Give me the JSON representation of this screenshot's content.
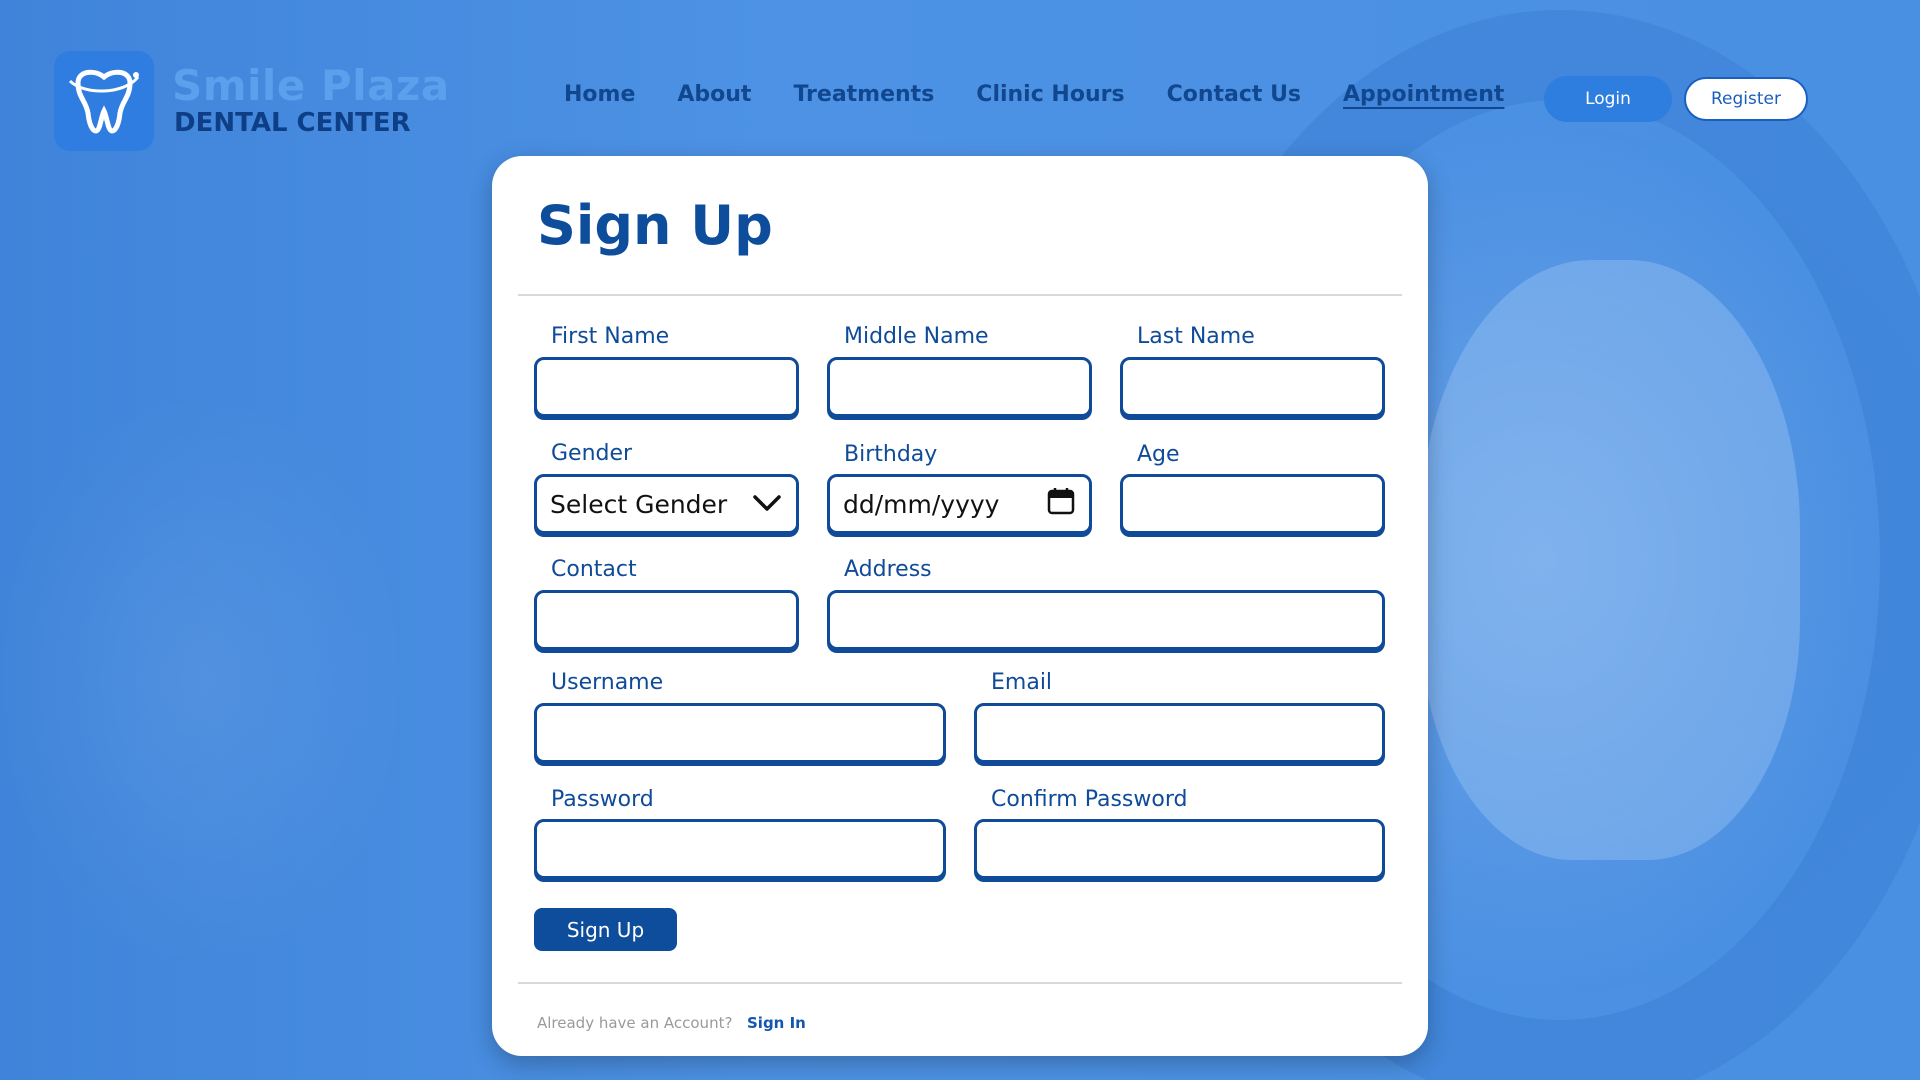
{
  "brand": {
    "name": "Smile Plaza",
    "subtitle": "DENTAL CENTER",
    "icon": "tooth-icon"
  },
  "nav": {
    "items": [
      "Home",
      "About",
      "Treatments",
      "Clinic Hours",
      "Contact Us",
      "Appointment"
    ],
    "active": "Appointment"
  },
  "auth": {
    "login_label": "Login",
    "register_label": "Register"
  },
  "form": {
    "title": "Sign Up",
    "labels": {
      "first_name": "First Name",
      "middle_name": "Middle Name",
      "last_name": "Last Name",
      "gender": "Gender",
      "birthday": "Birthday",
      "age": "Age",
      "contact": "Contact",
      "address": "Address",
      "username": "Username",
      "email": "Email",
      "password": "Password",
      "confirm_password": "Confirm Password"
    },
    "values": {
      "gender_selected": "Select Gender",
      "birthday_placeholder": "dd/mm/yyyy"
    },
    "submit_label": "Sign Up",
    "footer_text": "Already have an Account?",
    "footer_link": "Sign In"
  },
  "colors": {
    "background": "#4a8fe0",
    "primary": "#0e4d9c",
    "accent": "#2e7ee0",
    "card": "#ffffff"
  }
}
